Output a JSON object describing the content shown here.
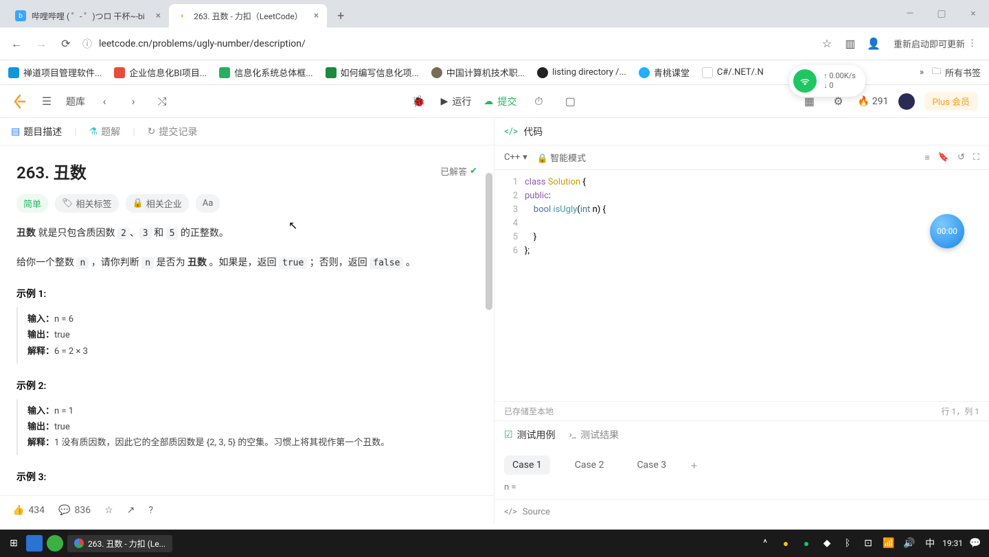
{
  "chrome": {
    "tabs": [
      {
        "icon_bg": "#3aa6ff",
        "title": "哔哩哔哩 ( ゜- ゜)つロ 干杯~-bi"
      },
      {
        "icon_bg": "#ff9a1e",
        "title": "263. 丑数 - 力扣（LeetCode）"
      }
    ],
    "url": "leetcode.cn/problems/ugly-number/description/",
    "reconnect": "重新启动即可更新"
  },
  "bookmarks": [
    {
      "icon": "#1296db",
      "label": "禅道项目管理软件..."
    },
    {
      "icon": "#e74c3c",
      "label": "企业信息化BI项目..."
    },
    {
      "icon": "#27ae60",
      "label": "信息化系统总体框..."
    },
    {
      "icon": "#1b8a3f",
      "label": "如何编写信息化项..."
    },
    {
      "icon": "#7a6a58",
      "label": "中国计算机技术职..."
    },
    {
      "icon": "#222",
      "label": "listing directory /..."
    },
    {
      "icon": "#1fb0ff",
      "label": "青桃课堂"
    },
    {
      "icon": "#5c4db1",
      "label": "C#/.NET/.N"
    }
  ],
  "bookmarks_more": "»",
  "all_bookmarks": "所有书签",
  "net": {
    "up": "0.00K/s",
    "down": "0"
  },
  "lc_toolbar": {
    "library": "题库",
    "run": "运行",
    "submit": "提交",
    "streak": "291",
    "plus": "Plus 会员"
  },
  "left_tabs": {
    "desc": "题目描述",
    "solution": "题解",
    "submissions": "提交记录"
  },
  "problem": {
    "title": "263. 丑数",
    "solved": "已解答",
    "difficulty": "简单",
    "related_tags": "相关标签",
    "related_co": "相关企业",
    "hint": "Aa",
    "para1_pre": "丑数",
    "para1_mid1": " 就是只包含质因数 ",
    "code2": "2",
    "comma": "、",
    "code3": "3",
    "and": " 和 ",
    "code5": "5",
    "para1_post": " 的正整数。",
    "para2_pre": "给你一个整数 ",
    "code_n": "n",
    "para2_mid": " ，请你判断 ",
    "code_n2": "n",
    "para2_mid2": " 是否为 ",
    "bold_ugly": "丑数",
    "para2_mid3": " 。如果是，返回 ",
    "code_true": "true",
    "para2_mid4": " ；否则，返回 ",
    "code_false": "false",
    "para2_end": " 。",
    "ex1_title": "示例 1:",
    "ex1_in_l": "输入：",
    "ex1_in_v": "n = 6",
    "ex1_out_l": "输出：",
    "ex1_out_v": "true",
    "ex1_exp_l": "解释：",
    "ex1_exp_v": "6 = 2 × 3",
    "ex2_title": "示例 2:",
    "ex2_in_l": "输入：",
    "ex2_in_v": "n = 1",
    "ex2_out_l": "输出：",
    "ex2_out_v": "true",
    "ex2_exp_l": "解释：",
    "ex2_exp_v": "1 没有质因数，因此它的全部质因数是 {2, 3, 5} 的空集。习惯上将其视作第一个丑数。",
    "ex3_title": "示例 3:"
  },
  "left_footer": {
    "likes": "434",
    "comments": "836"
  },
  "code_panel": {
    "header": "代码",
    "lang": "C++",
    "smart": "智能模式",
    "saved": "已存储至本地",
    "cursor": "行 1，列 1",
    "lines": [
      "class Solution {",
      "public:",
      "    bool isUgly(int n) {",
      "",
      "    }",
      "};"
    ]
  },
  "test": {
    "cases_tab": "测试用例",
    "results_tab": "测试结果",
    "case1": "Case 1",
    "case2": "Case 2",
    "case3": "Case 3",
    "input_label": "n =",
    "source": "Source"
  },
  "timer": "00:00",
  "taskbar": {
    "app": "263. 丑数 - 力扣 (Le...",
    "time": "19:31"
  }
}
